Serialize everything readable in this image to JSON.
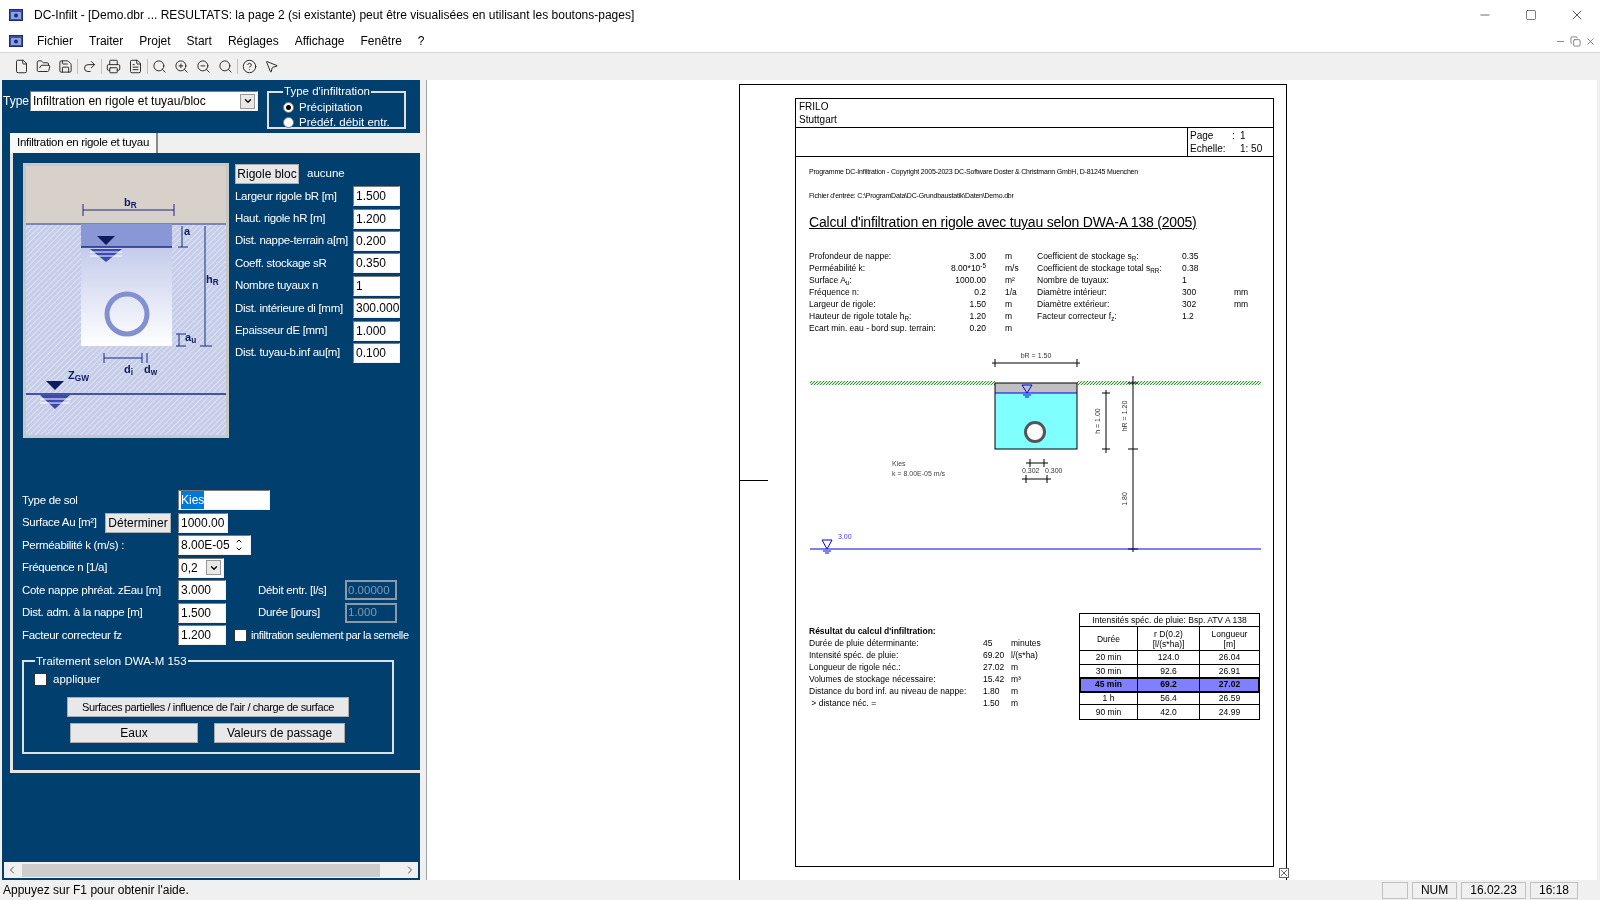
{
  "window": {
    "title": "DC-Infilt - [Demo.dbr ... RESULTATS: la page 2 (si existante) peut être visualisées en utilisant les boutons-pages]"
  },
  "menu": [
    "Fichier",
    "Traiter",
    "Projet",
    "Start",
    "Réglages",
    "Affichage",
    "Fenêtre",
    "?"
  ],
  "left_panel": {
    "type_label": "Type",
    "type_value": "Infiltration en rigole et tuyau/bloc",
    "infiltration_type": {
      "title": "Type d'infiltration",
      "options": [
        {
          "label": "Précipitation",
          "selected": true
        },
        {
          "label": "Prédéf. débit entr.",
          "selected": false
        }
      ]
    },
    "tabs": [
      {
        "label": "Infiltration en rigole et tuyau",
        "selected": true
      }
    ],
    "diagram_labels": [
      "b$_{R}$",
      "a",
      "h$_{R}$",
      "a$_{u}$",
      "d$_{i}$",
      "d$_{w}$",
      "Z$_{GW}$"
    ],
    "rigole_button": "Rigole bloc",
    "rigole_value": "aucune",
    "fields": [
      {
        "label": "Largeur rigole bR [m]",
        "value": "1.500"
      },
      {
        "label": "Haut. rigole hR [m]",
        "value": "1.200"
      },
      {
        "label": "Dist. nappe-terrain a[m]",
        "value": "0.200"
      },
      {
        "label": "Coeff. stockage sR",
        "value": "0.350"
      },
      {
        "label": "Nombre tuyaux n",
        "value": "1"
      },
      {
        "label": "Dist. intérieure di [mm]",
        "value": "300.000"
      },
      {
        "label": "Epaisseur dE [mm]",
        "value": "1.000"
      },
      {
        "label": "Dist. tuyau-b.inf au[m]",
        "value": "0.100"
      }
    ],
    "soil_type": {
      "label": "Type de sol",
      "value": "Kies",
      "text_selected": true
    },
    "surface": {
      "label": "Surface Au [m²]",
      "button": "Déterminer",
      "value": "1000.00"
    },
    "permeability": {
      "label": "Perméabilité k (m/s) :",
      "value": "8.00E-05"
    },
    "frequency": {
      "label": "Fréquence n [1/a]",
      "value": "0,2"
    },
    "groundwater": {
      "label": "Cote nappe phréat. zEau [m]",
      "value": "3.000"
    },
    "inflow": {
      "label": "Débit entr. [l/s]",
      "value": "0.00000",
      "disabled": true
    },
    "distance": {
      "label": "Dist. adm. à la nappe [m]",
      "value": "1.500"
    },
    "duration": {
      "label": "Durée [jours]",
      "value": "1.000",
      "disabled": true
    },
    "factor": {
      "label": "Facteur correcteur fz",
      "value": "1.200"
    },
    "base_only": {
      "label": "infiltration seulement par la semelle",
      "checked": false
    },
    "dwa": {
      "title": "Traitement selon DWA-M 153",
      "apply": {
        "label": "appliquer",
        "checked": false
      },
      "buttons": [
        "Surfaces partielles / influence de l'air / charge de surface",
        "Eaux",
        "Valeurs de passage"
      ]
    }
  },
  "document": {
    "company": "FRILO",
    "city": "Stuttgart",
    "page_label": "Page",
    "page_sep": ":",
    "page": "1",
    "scale_label": "Echelle:",
    "scale": "1: 50",
    "copyright": "Programme DC-Infiltration - Copyright 2005-2023 DC-Software Doster & Christmann GmbH, D-81245 Muenchen",
    "input_file": "Fichier d'entrée: C:\\ProgramData\\DC-Grundbaustatik\\Daten\\Demo.dbr",
    "title": "Calcul d'infiltration en rigole avec tuyau selon DWA-A 138 (2005)",
    "params_left": [
      {
        "label": "Profondeur de nappe:",
        "value": "3.00",
        "unit": "m"
      },
      {
        "label": "Perméabilité k:",
        "value": "8.00*10$^{-5}$",
        "unit": "m/s"
      },
      {
        "label": "Surface A$_{u}$:",
        "value": "1000.00",
        "unit": "m²"
      },
      {
        "label": "Fréquence n:",
        "value": "0.2",
        "unit": "1/a"
      },
      {
        "label": "Largeur de rigole:",
        "value": "1.50",
        "unit": "m"
      },
      {
        "label": "Hauteur de rigole totale h$_{R}$:",
        "value": "1.20",
        "unit": "m"
      },
      {
        "label": "Ecart min. eau - bord sup. terrain:",
        "value": "0.20",
        "unit": "m"
      }
    ],
    "params_right": [
      {
        "label": "Coefficient de stockage s$_{R}$:",
        "value": "0.35"
      },
      {
        "label": "Coefficient de stockage total s$_{RR}$:",
        "value": "0.38"
      },
      {
        "label": "Nombre de tuyaux:",
        "value": "1"
      },
      {
        "label": "Diamètre intérieur:",
        "value": "300",
        "unit": "mm"
      },
      {
        "label": "Diamètre extérieur:",
        "value": "302",
        "unit": "mm"
      },
      {
        "label": "Facteur correcteur f$_{z}$:",
        "value": "1.2"
      }
    ],
    "drawing": {
      "width_dim": "bR = 1.50",
      "h_dim": "h = 1.00",
      "hr_dim": "hR = 1.20",
      "soil": "Kies",
      "k": "k = 8.00E-05 m/s",
      "pipe_outer": "0.302",
      "pipe_inner": "0.300",
      "depth_dim": "1.80",
      "water_level": "3.00"
    },
    "results": {
      "title": "Résultat du calcul d'infiltration:",
      "rows": [
        {
          "label": "Durée de pluie déterminante:",
          "value": "45",
          "unit": "minutes"
        },
        {
          "label": "Intensité spéc. de pluie:",
          "value": "69.20",
          "unit": "l/(s*ha)"
        },
        {
          "label": "Longueur de rigole néc.:",
          "value": "27.02",
          "unit": "m"
        },
        {
          "label": "Volumes de stockage nécessaire:",
          "value": "15.42",
          "unit": "m³"
        },
        {
          "label": "Distance du bord inf. au niveau de nappe:",
          "value": "1.80",
          "unit": "m"
        },
        {
          "label": " > distance néc. =",
          "value": "1.50",
          "unit": "m"
        }
      ]
    },
    "rain_table": {
      "title": "Intensités spéc. de pluie: Bsp. ATV A 138",
      "columns": [
        "Durée",
        "r D(0.2)\n[l/(s*ha)]",
        "Longueur\n[m]"
      ],
      "rows": [
        {
          "cells": [
            "20 min",
            "124.0",
            "26.04"
          ],
          "selected": false
        },
        {
          "cells": [
            "30 min",
            "92.6",
            "26.91"
          ],
          "selected": false
        },
        {
          "cells": [
            "45 min",
            "69.2",
            "27.02"
          ],
          "selected": true
        },
        {
          "cells": [
            "1 h",
            "56.4",
            "26.59"
          ],
          "selected": false
        },
        {
          "cells": [
            "90 min",
            "42.0",
            "24.99"
          ],
          "selected": false
        }
      ]
    }
  },
  "status_bar": {
    "help": "Appuyez sur F1 pour obtenir l'aide.",
    "indicators": [
      "NUM",
      "16.02.23",
      "16:18"
    ]
  }
}
